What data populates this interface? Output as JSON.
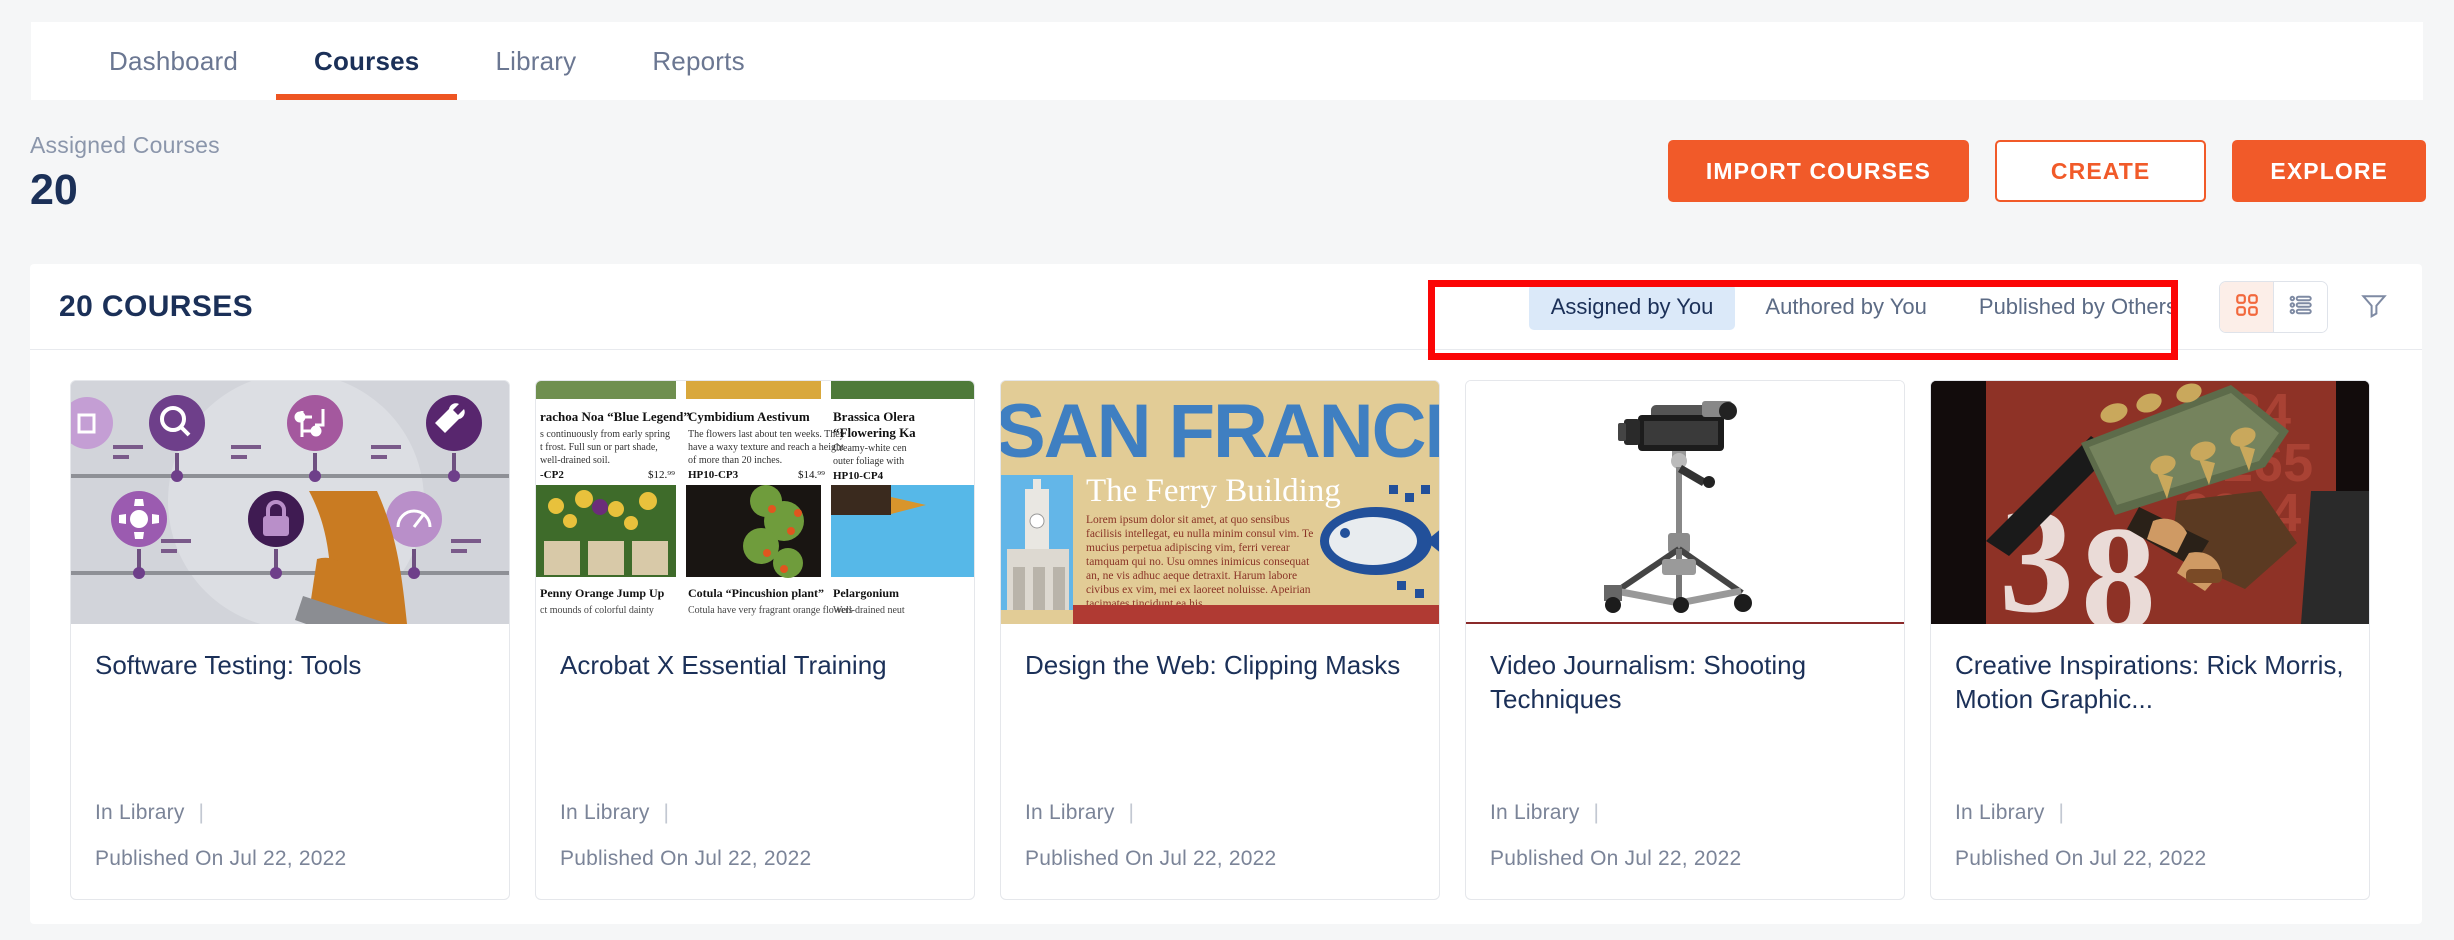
{
  "nav": {
    "tabs": [
      {
        "label": "Dashboard",
        "active": false
      },
      {
        "label": "Courses",
        "active": true
      },
      {
        "label": "Library",
        "active": false
      },
      {
        "label": "Reports",
        "active": false
      }
    ]
  },
  "summary": {
    "label": "Assigned Courses",
    "value": "20"
  },
  "actions": {
    "import_label": "IMPORT COURSES",
    "create_label": "CREATE",
    "explore_label": "EXPLORE"
  },
  "panel": {
    "title": "20 COURSES",
    "filters": [
      {
        "label": "Assigned by You",
        "active": true
      },
      {
        "label": "Authored by You",
        "active": false
      },
      {
        "label": "Published by Others",
        "active": false
      }
    ],
    "view_modes": [
      {
        "name": "grid-view",
        "active": true
      },
      {
        "name": "list-view",
        "active": false
      }
    ],
    "filter_icon": "funnel-icon"
  },
  "colors": {
    "accent_orange": "#f15a29",
    "navy": "#1b3058",
    "active_pill": "#dbe9f9",
    "highlight_red": "#fb0606"
  },
  "courses": [
    {
      "title": "Software Testing: Tools",
      "status": "In Library",
      "published": "Published On Jul 22, 2022",
      "thumb": "software-testing-icons-illustration"
    },
    {
      "title": "Acrobat X Essential Training",
      "status": "In Library",
      "published": "Published On Jul 22, 2022",
      "thumb": "plant-catalog-page"
    },
    {
      "title": "Design the Web: Clipping Masks",
      "status": "In Library",
      "published": "Published On Jul 22, 2022",
      "thumb": "san-francisco-ferry-building"
    },
    {
      "title": "Video Journalism: Shooting Techniques",
      "status": "In Library",
      "published": "Published On Jul 22, 2022",
      "thumb": "video-camera-tripod"
    },
    {
      "title": "Creative Inspirations: Rick Morris, Motion Graphic...",
      "status": "In Library",
      "published": "Published On Jul 22, 2022",
      "thumb": "guitar-player-number-38"
    }
  ]
}
